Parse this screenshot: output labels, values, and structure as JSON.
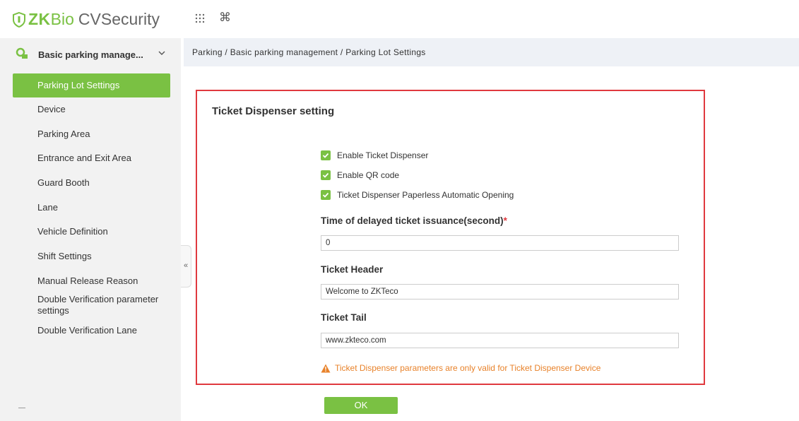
{
  "app": {
    "logo_zk": "ZK",
    "logo_bio": "Bio",
    "logo_cv": "CVSecurity",
    "apps_icon": "apps-grid-icon",
    "command_icon": "command-icon",
    "brand_color": "#7ac143"
  },
  "sidebar": {
    "module_label": "Basic parking manage...",
    "items": [
      {
        "label": "Parking Lot Settings",
        "active": true
      },
      {
        "label": "Device"
      },
      {
        "label": "Parking Area"
      },
      {
        "label": "Entrance and Exit Area"
      },
      {
        "label": "Guard Booth"
      },
      {
        "label": "Lane"
      },
      {
        "label": "Vehicle Definition"
      },
      {
        "label": "Shift Settings"
      },
      {
        "label": "Manual Release Reason"
      },
      {
        "label": "Double Verification parameter settings"
      },
      {
        "label": "Double Verification Lane"
      }
    ],
    "collapse_glyph": "«"
  },
  "breadcrumb": "Parking / Basic parking management / Parking Lot Settings",
  "panel": {
    "title": "Ticket Dispenser setting",
    "checkboxes": [
      {
        "label": "Enable Ticket Dispenser",
        "checked": true
      },
      {
        "label": "Enable QR code",
        "checked": true
      },
      {
        "label": "Ticket Dispenser Paperless Automatic Opening",
        "checked": true
      }
    ],
    "delay_label": "Time of delayed ticket issuance(second)",
    "delay_required": "*",
    "delay_value": "0",
    "header_label": "Ticket Header",
    "header_value": "Welcome to ZKTeco",
    "tail_label": "Ticket Tail",
    "tail_value": "www.zkteco.com",
    "warning": "Ticket Dispenser parameters are only valid for Ticket Dispenser Device",
    "highlight_color": "#e0393e",
    "warning_color": "#e8822a"
  },
  "ok_label": "OK"
}
